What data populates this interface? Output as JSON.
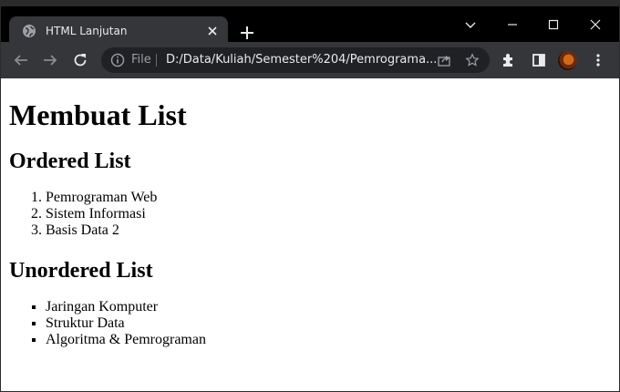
{
  "browser": {
    "tab_title": "HTML Lanjutan",
    "scheme_label": "File",
    "url": "D:/Data/Kuliah/Semester%204/Pemrograma...",
    "colors": {
      "tabstrip": "#000000",
      "toolbar": "#35363a",
      "omnibox": "#202124",
      "text": "#e8eaed"
    }
  },
  "page": {
    "heading": "Membuat List",
    "ordered": {
      "heading": "Ordered List",
      "items": [
        "Pemrograman Web",
        "Sistem Informasi",
        "Basis Data 2"
      ]
    },
    "unordered": {
      "heading": "Unordered List",
      "items": [
        "Jaringan Komputer",
        "Struktur Data",
        "Algoritma & Pemrograman"
      ]
    }
  }
}
